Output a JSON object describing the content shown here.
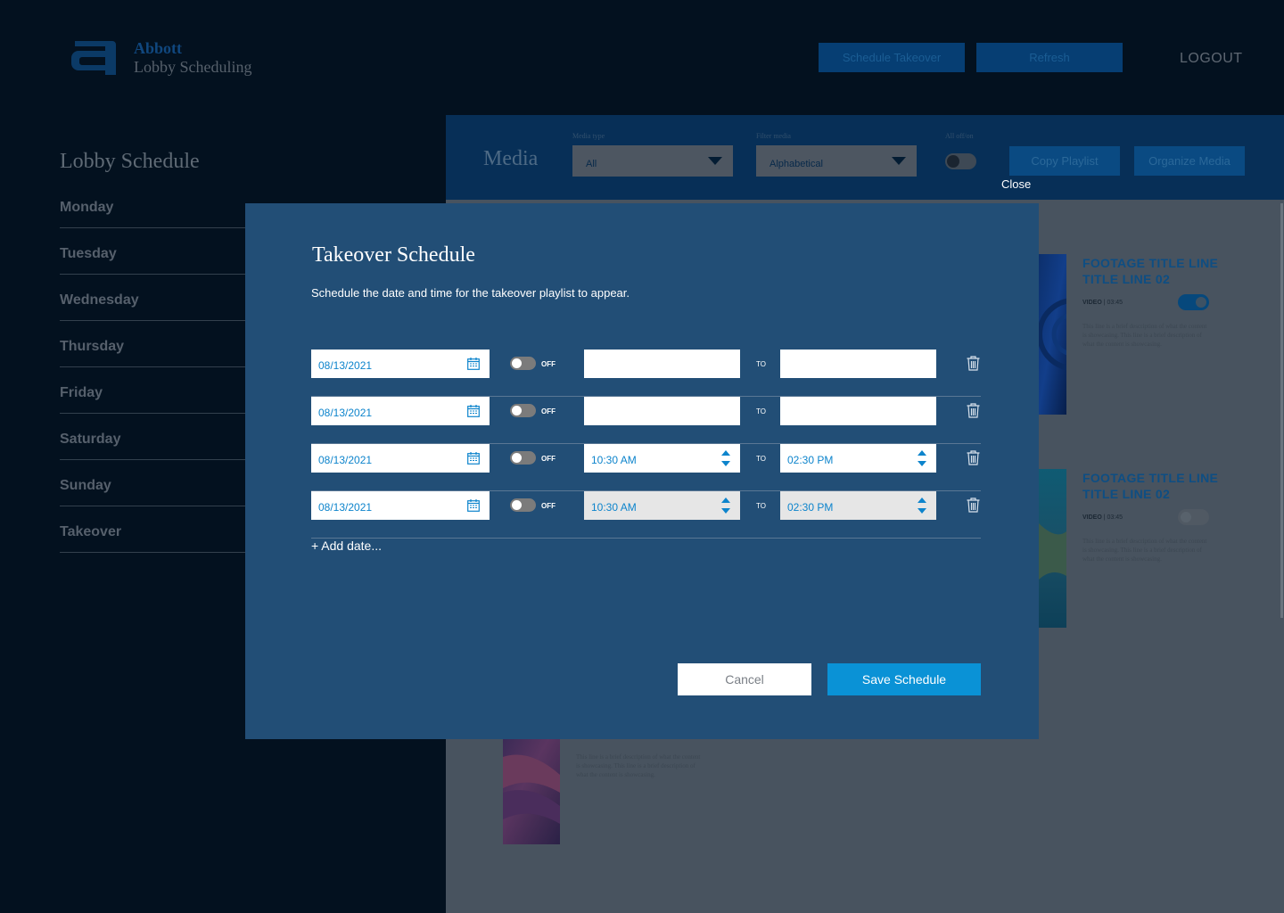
{
  "header": {
    "brand": "Abbott",
    "app_name": "Lobby Scheduling",
    "schedule_takeover_label": "Schedule Takeover",
    "refresh_label": "Refresh",
    "logout_label": "LOGOUT"
  },
  "sidebar": {
    "title": "Lobby Schedule",
    "items": [
      {
        "label": "Monday"
      },
      {
        "label": "Tuesday"
      },
      {
        "label": "Wednesday"
      },
      {
        "label": "Thursday"
      },
      {
        "label": "Friday"
      },
      {
        "label": "Saturday"
      },
      {
        "label": "Sunday"
      },
      {
        "label": "Takeover"
      }
    ]
  },
  "media": {
    "title": "Media",
    "media_type_label": "Media type",
    "media_type_value": "All",
    "filter_label": "Filter media",
    "filter_value": "Alphabetical",
    "all_toggle_label": "All off/on",
    "copy_playlist_label": "Copy Playlist",
    "organize_media_label": "Organize Media",
    "close_label": "Close",
    "cards": [
      {
        "title": "FOOTAGE TITLE LINE TITLE LINE 02",
        "type": "VIDEO",
        "duration": "03:45",
        "enabled": true,
        "description": "This line is a brief description of what the content is showcasing. This line is a brief description of what the content is showcasing."
      },
      {
        "title": "FOOTAGE TITLE LINE TITLE LINE 02",
        "type": "VIDEO",
        "duration": "03:45",
        "enabled": false,
        "description": "This line is a brief description of what the content is showcasing. This line is a brief description of what the content is showcasing."
      },
      {
        "description": "This line is a brief description of what the content is showcasing. This line is a brief description of what the content is showcasing."
      }
    ]
  },
  "modal": {
    "title": "Takeover Schedule",
    "subtitle": "Schedule the date and time for the takeover playlist to appear.",
    "off_label": "OFF",
    "to_label": "TO",
    "rows": [
      {
        "date": "08/13/2021",
        "from": "",
        "to": "",
        "toggle_on": false
      },
      {
        "date": "08/13/2021",
        "from": "",
        "to": "",
        "toggle_on": false
      },
      {
        "date": "08/13/2021",
        "from": "10:30 AM",
        "to": "02:30 PM",
        "toggle_on": false
      },
      {
        "date": "08/13/2021",
        "from": "10:30 AM",
        "to": "02:30 PM",
        "toggle_on": false,
        "time_disabled": true
      }
    ],
    "add_date_label": "+ Add date...",
    "cancel_label": "Cancel",
    "save_label": "Save Schedule"
  },
  "colors": {
    "page_bg": "#03111f",
    "modal_bg": "#224e76",
    "accent": "#0a92d6",
    "input_text": "#0d84cc"
  }
}
